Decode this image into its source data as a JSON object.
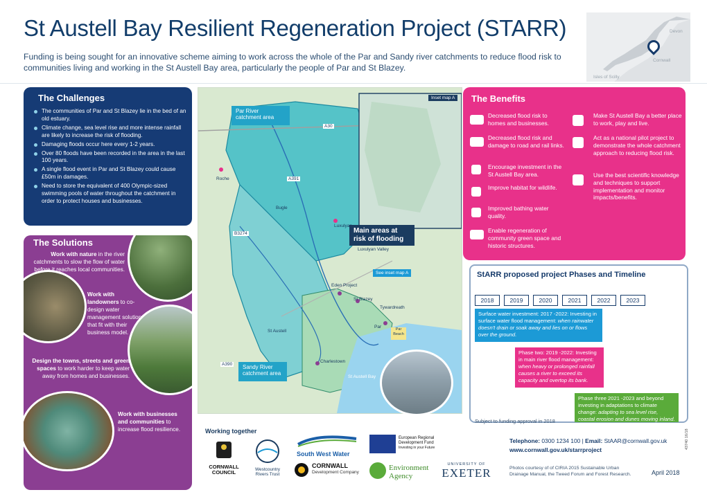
{
  "header": {
    "title": "St Austell Bay Resilient Regeneration Project (STARR)",
    "intro": "Funding is being sought for an innovative scheme aiming to work across the whole of the Par and Sandy river catchments to reduce flood risk to communities living and working in the St Austell Bay area, particularly the people of Par and St Blazey."
  },
  "location_map": {
    "labels": [
      "Devon",
      "Cornwall",
      "Isles of Scilly"
    ]
  },
  "challenges": {
    "heading": "The Challenges",
    "items": [
      "The communities of Par and St Blazey lie in the bed of an old estuary.",
      "Climate change, sea level rise and more intense rainfall are likely to increase the risk of flooding.",
      "Damaging floods occur here every 1-2 years.",
      "Over 80 floods have been recorded in the area in the last 100 years.",
      "A single flood event in Par and St Blazey could cause £50m in damages.",
      "Need to store the equivalent of 400 Olympic-sized swimming pools of water throughout the catchment in order to protect houses and businesses."
    ]
  },
  "solutions": {
    "heading": "The Solutions",
    "s1_bold": "Work with nature",
    "s1_rest": " in the river catchments to slow the flow of water before it reaches local communities.",
    "s2_bold": "Work with landowners",
    "s2_rest": " to co-design water management solutions that fit with their business model.",
    "s3_bold": "Design the towns, streets and green spaces",
    "s3_rest": " to work harder to keep water away from homes and businesses.",
    "s4_bold": "Work with businesses and communities",
    "s4_rest": " to increase flood resilience."
  },
  "map": {
    "par_river": "Par River",
    "par_catchment": "catchment area",
    "sandy_river": "Sandy River",
    "sandy_catchment": "catchment area",
    "inset_label": "Inset map A",
    "see_inset": "See inset map A",
    "main_areas_1": "Main areas at",
    "main_areas_2": "risk of flooding",
    "places": [
      "Roche",
      "Bugle",
      "Luxulyan",
      "Luxulyan Valley",
      "St Blazey",
      "Tywardreath",
      "Par",
      "Par Beach",
      "St Austell",
      "Charlestown",
      "St Austell Bay",
      "Eden Project"
    ],
    "roads": [
      "A30",
      "A391",
      "B3274",
      "A390"
    ]
  },
  "benefits": {
    "heading": "The Benefits",
    "left": [
      "Decreased flood risk to homes and businesses.",
      "Decreased flood risk and damage to road and rail links.",
      "Encourage investment in the St Austell Bay area.",
      "Improve habitat for wildlife.",
      "Improved bathing water quality.",
      "Enable regeneration of community green space and historic structures."
    ],
    "right": [
      "Make St Austell Bay a better place to work, play and live.",
      "Act as a national pilot project to demonstrate the whole catchment approach to reducing flood risk.",
      "Use the best scientific knowledge and techniques to support implementation and monitor impacts/benefits."
    ]
  },
  "phases": {
    "heading": "StARR proposed project Phases and Timeline",
    "years": [
      "2018",
      "2019",
      "2020",
      "2021",
      "2022",
      "2023"
    ],
    "phase1_main": "Surface water investment: 2017 -2022: Investing in surface water flood management: ",
    "phase1_italic": "when rainwater doesn't drain or soak away and lies on or flows over the ground.",
    "phase2_main": "Phase two: 2019 -2022: Investing in main river flood management: ",
    "phase2_italic": "when heavy or prolonged rainfall causes a river to exceed its capacity and overtop its bank.",
    "phase3_main": "Phase three 2021 -2023 and beyond investing in adaptations to climate change: ",
    "phase3_italic": "adapting to sea level rise, coastal erosion and dunes moving inland.",
    "subject": "Subject to funding approval in 2018",
    "colors": {
      "phase1": "#1c9ad6",
      "phase2": "#e8318a",
      "phase3": "#5aab3a"
    }
  },
  "contact": {
    "telephone_label": "Telephone:",
    "telephone": "0300 1234 100",
    "separator": "|",
    "email_label": "Email:",
    "email": "StAAR@cornwall.gov.uk",
    "website": "www.cornwall.gov.uk/starrproject"
  },
  "footer": {
    "working_together": "Working together",
    "credits": "Photos courtesy of of CIRIA 2015 Sustainable Urban Drainage Manual, the Tweed Forum and Forest Research.",
    "date": "April 2018",
    "code": "43740 16/18"
  },
  "logos": {
    "cornwall": "CORNWALL COUNCIL",
    "cornwall_1": "CORNWALL",
    "cornwall_2": "COUNCIL",
    "westcountry": "Westcountry Rivers Trust",
    "westcountry_1": "Westcountry",
    "westcountry_2": "Rivers Trust",
    "swwater": "South West Water",
    "cdc_1": "CORNWALL",
    "cdc_2": "Development Company",
    "erdf_1": "European Regional",
    "erdf_2": "Development Fund",
    "erdf_3": "Investing in your Future",
    "env_1": "Environment",
    "env_2": "Agency",
    "exeter_small": "UNIVERSITY OF",
    "exeter": "EXETER"
  }
}
